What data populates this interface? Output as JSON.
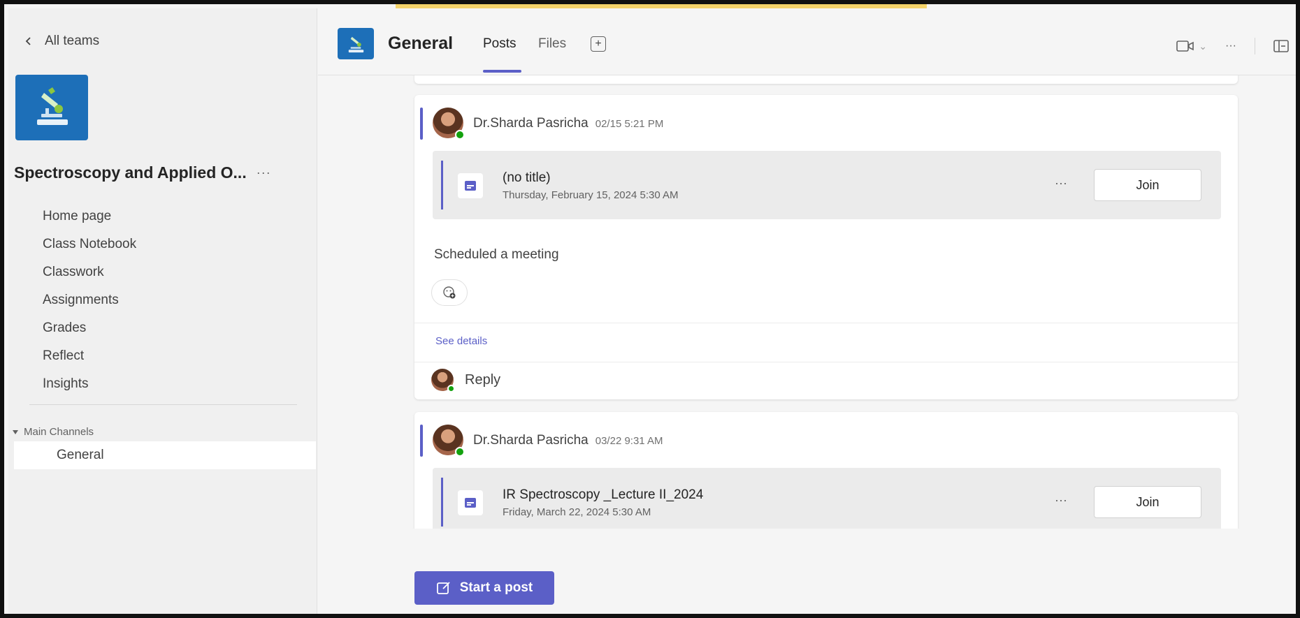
{
  "sidebar": {
    "back_label": "All teams",
    "team_name": "Spectroscopy and Applied O...",
    "team_more": "···",
    "nav_items": [
      {
        "label": "Home page"
      },
      {
        "label": "Class Notebook"
      },
      {
        "label": "Classwork"
      },
      {
        "label": "Assignments"
      },
      {
        "label": "Grades"
      },
      {
        "label": "Reflect"
      },
      {
        "label": "Insights"
      }
    ],
    "section_label": "Main Channels",
    "channels": [
      {
        "label": "General",
        "selected": true
      }
    ]
  },
  "header": {
    "channel_name": "General",
    "tabs": [
      {
        "label": "Posts",
        "active": true
      },
      {
        "label": "Files",
        "active": false
      }
    ],
    "add_tab_symbol": "+",
    "more_symbol": "···",
    "video_dropdown_symbol": "⌄"
  },
  "posts": [
    {
      "author": "Dr.Sharda Pasricha",
      "timestamp": "02/15 5:21 PM",
      "meeting": {
        "title": "(no title)",
        "datetime": "Thursday, February 15, 2024 5:30 AM",
        "more": "···",
        "join_label": "Join"
      },
      "message": "Scheduled a meeting",
      "see_details": "See details",
      "reply_label": "Reply"
    },
    {
      "author": "Dr.Sharda Pasricha",
      "timestamp": "03/22 9:31 AM",
      "meeting": {
        "title": "IR Spectroscopy _Lecture II_2024",
        "datetime": "Friday, March 22, 2024 5:30 AM",
        "more": "···",
        "join_label": "Join"
      }
    }
  ],
  "compose": {
    "start_post_label": "Start a post"
  },
  "colors": {
    "accent": "#5b5fc7",
    "team_logo_bg": "#1d6fb8",
    "presence_available": "#13a10e"
  },
  "icons": {
    "back": "chevron-left-icon",
    "team_logo": "microscope-icon",
    "video": "video-camera-icon",
    "panel": "side-panel-icon",
    "meeting": "calendar-icon",
    "reaction": "emoji-reaction-icon",
    "compose": "compose-icon"
  }
}
